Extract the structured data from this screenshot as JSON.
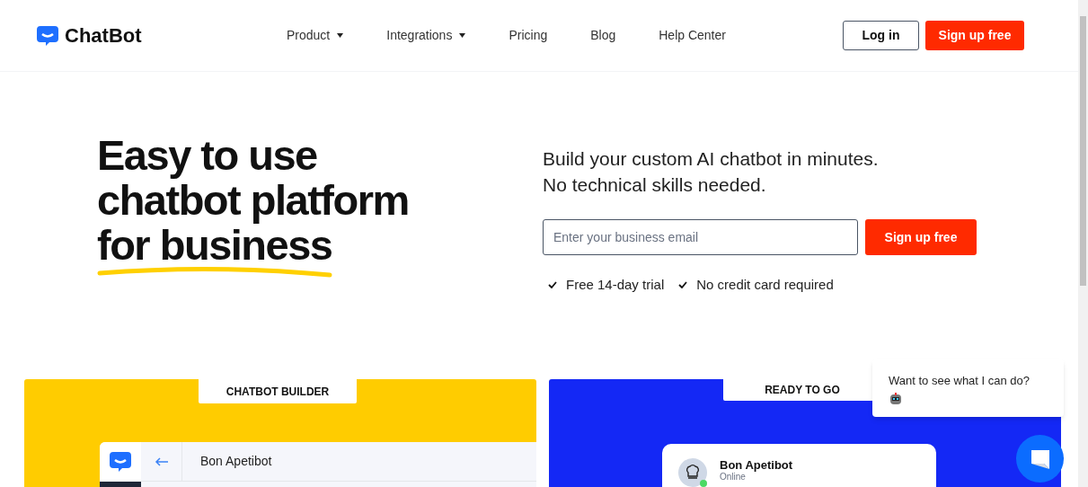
{
  "header": {
    "logo": "ChatBot",
    "nav": [
      {
        "label": "Product",
        "has_dropdown": true
      },
      {
        "label": "Integrations",
        "has_dropdown": true
      },
      {
        "label": "Pricing",
        "has_dropdown": false
      },
      {
        "label": "Blog",
        "has_dropdown": false
      },
      {
        "label": "Help Center",
        "has_dropdown": false
      }
    ],
    "login": "Log in",
    "signup": "Sign up free"
  },
  "hero": {
    "headline": [
      "Easy to use",
      "chatbot platform",
      "for business"
    ],
    "subtitle": [
      "Build your custom AI chatbot in minutes.",
      "No technical skills needed."
    ],
    "email": {
      "placeholder": "Enter your business email"
    },
    "cta": "Sign up free",
    "perks": [
      "Free 14-day trial",
      "No credit card required"
    ]
  },
  "cards": [
    {
      "kind": "builder",
      "tab": "CHATBOT BUILDER",
      "bot_name": "Bon Apetibot"
    },
    {
      "kind": "ready",
      "tab": "READY TO GO",
      "bot_name": "Bon Apetibot",
      "status": "Online"
    }
  ],
  "chat_widget": {
    "message": "Want to see what I can do?"
  }
}
